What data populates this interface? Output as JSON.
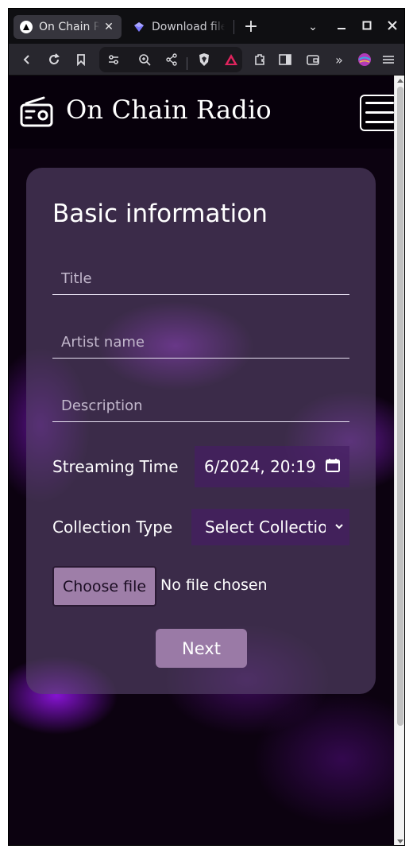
{
  "browser": {
    "tabs": [
      {
        "title": "On Chain Radio",
        "active": true,
        "icon": "triangle-logo-icon"
      },
      {
        "title": "Download file",
        "active": false,
        "icon": "gem-icon"
      }
    ],
    "new_tab_label": "+",
    "toolbar_icons": [
      "back-icon",
      "reload-icon",
      "bookmark-icon",
      "site-settings-icon",
      "zoom-icon",
      "share-icon",
      "brave-shield-icon",
      "brave-rewards-icon",
      "extensions-icon",
      "sidebar-icon",
      "wallet-icon",
      "more-icon",
      "profile-icon",
      "menu-icon"
    ]
  },
  "site": {
    "brand": "On Chain Radio"
  },
  "form": {
    "heading": "Basic information",
    "title_placeholder": "Title",
    "artist_placeholder": "Artist name",
    "description_placeholder": "Description",
    "streaming_time_label": "Streaming Time",
    "streaming_time_value": "6/2024, 20:19",
    "collection_type_label": "Collection Type",
    "collection_type_value": "Select Collection",
    "file_button_label": "Choose file",
    "file_status": "No file chosen",
    "next_label": "Next"
  },
  "colors": {
    "accent_purple": "#9a7aa6",
    "card_bg": "#58466c",
    "page_bg": "#0c0210"
  }
}
